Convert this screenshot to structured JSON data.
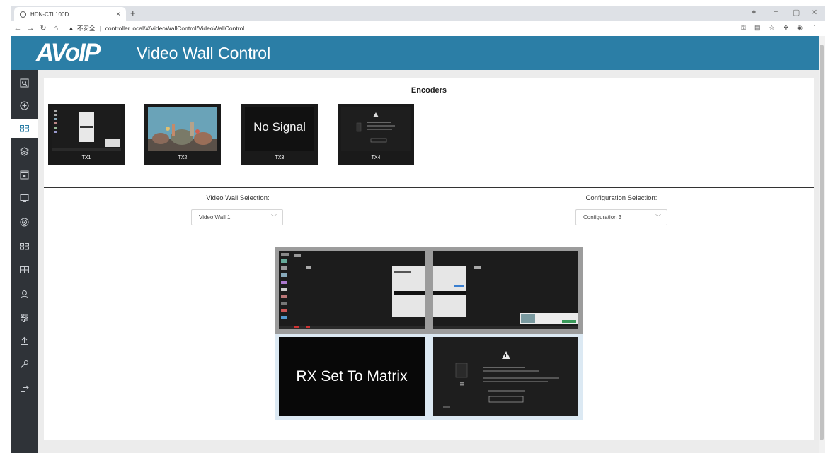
{
  "browser": {
    "tab_title": "HDN-CTL100D",
    "tab_close": "×",
    "new_tab": "+",
    "security_label": "不安全",
    "url": "controller.local/#/VideoWallControl/VideoWallControl",
    "window_controls": [
      "−",
      "▢",
      "✕"
    ]
  },
  "header": {
    "logo": "AVoIP",
    "title": "Video Wall Control"
  },
  "sidebar": {
    "items": [
      {
        "icon": "search-icon"
      },
      {
        "icon": "plus-circle-icon"
      },
      {
        "icon": "video-wall-icon",
        "active": true
      },
      {
        "icon": "layers-icon"
      },
      {
        "icon": "media-icon"
      },
      {
        "icon": "monitor-icon"
      },
      {
        "icon": "target-icon"
      },
      {
        "icon": "grid-icon"
      },
      {
        "icon": "table-icon"
      },
      {
        "icon": "user-icon"
      },
      {
        "icon": "sliders-icon"
      },
      {
        "icon": "upgrade-icon"
      },
      {
        "icon": "wrench-icon"
      },
      {
        "icon": "logout-icon"
      }
    ]
  },
  "encoders": {
    "heading": "Encoders",
    "items": [
      {
        "label": "TX1",
        "content": "desktop"
      },
      {
        "label": "TX2",
        "content": "aquarium"
      },
      {
        "label": "TX3",
        "content": "No Signal"
      },
      {
        "label": "TX4",
        "content": "warning"
      }
    ]
  },
  "video_wall_selection": {
    "label": "Video Wall Selection:",
    "value": "Video Wall 1"
  },
  "configuration_selection": {
    "label": "Configuration Selection:",
    "value": "Configuration 3"
  },
  "wall": {
    "cells": [
      {
        "content": "desktop-left"
      },
      {
        "content": "desktop-right"
      },
      {
        "content": "RX Set To Matrix"
      },
      {
        "content": "warning"
      }
    ]
  }
}
